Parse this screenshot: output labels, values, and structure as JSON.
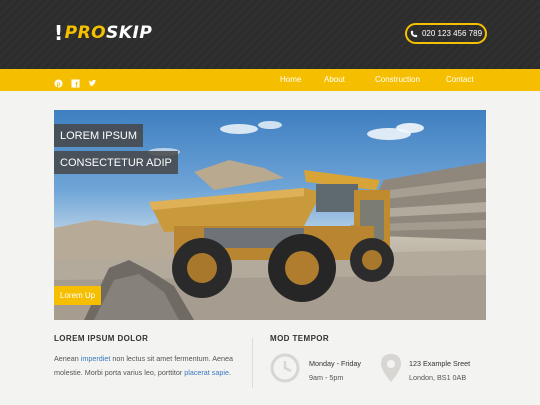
{
  "header": {
    "logo_mark": "!",
    "logo_pro": "PRO",
    "logo_skip": "SKIP",
    "phone": "020 123 456 789"
  },
  "social": [
    "pinterest-icon",
    "facebook-icon",
    "twitter-icon"
  ],
  "nav": {
    "items": [
      {
        "label": "Home"
      },
      {
        "label": "About"
      },
      {
        "label": "Construction"
      },
      {
        "label": "Contact"
      }
    ]
  },
  "hero": {
    "line1": "LOREM IPSUM",
    "line2": "CONSECTETUR ADIP",
    "button": "Lorem Up"
  },
  "about": {
    "title": "LOREM IPSUM DOLOR",
    "p1": "Aenean",
    "link1": "imperdiet",
    "p2": "non lectus sit amet fermentum. Aenea molestie. Morbi porta varius leo, porttitor",
    "link2": "placerat sapie",
    "p3": "."
  },
  "contact": {
    "title": "MOD TEMPOR",
    "hours_days": "Monday - Friday",
    "hours_time": "9am - 5pm",
    "address_line1": "123 Example Sreet",
    "address_line2": "London, BS1 0AB"
  },
  "colors": {
    "accent": "#f5bf00",
    "dark": "#2e2e2e",
    "link": "#3a78c0"
  }
}
